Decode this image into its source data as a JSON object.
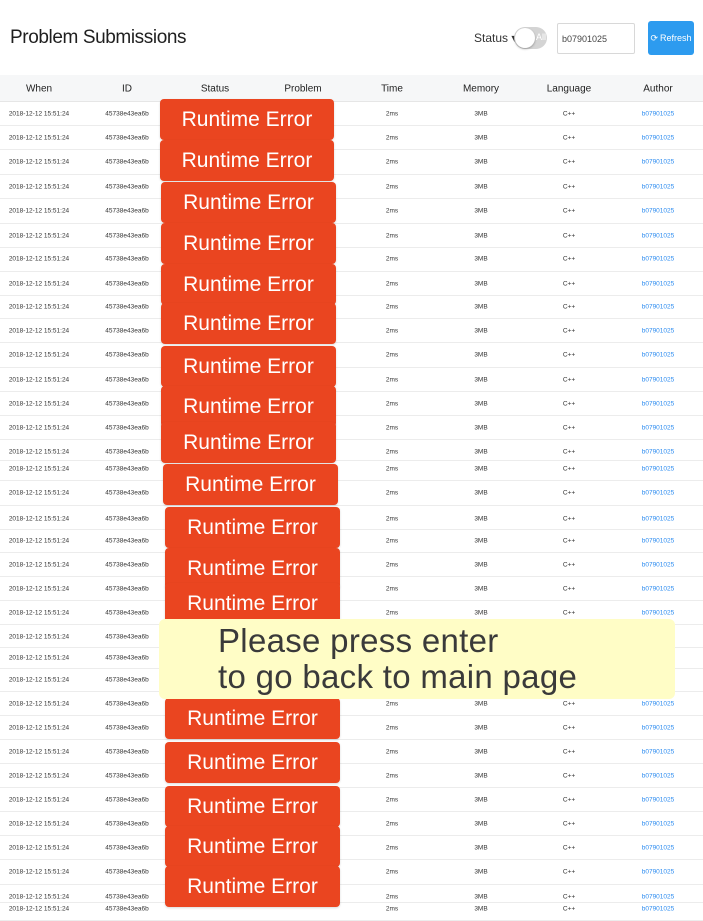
{
  "header": {
    "title": "Problem Submissions",
    "status_label": "Status ▾",
    "toggle_label": "All",
    "search_value": "b07901025",
    "refresh_label": "Refresh"
  },
  "columns": [
    "When",
    "ID",
    "Status",
    "Problem",
    "Time",
    "Memory",
    "Language",
    "Author"
  ],
  "row_values": {
    "when": "2018-12-12 15:51:24",
    "id": "45738e43ea6b",
    "time": "2ms",
    "memory": "3MB",
    "language": "C++",
    "author": "b07901025"
  },
  "row_count": 35,
  "badge_label": "Runtime Error",
  "badge_count": 23,
  "popup": {
    "line1": "Please press enter",
    "line2": "to go back to main page"
  },
  "colors": {
    "accent": "#2d9bef",
    "error": "#ea4520",
    "popup_bg": "#fffdc6",
    "link": "#2d8cf0"
  }
}
